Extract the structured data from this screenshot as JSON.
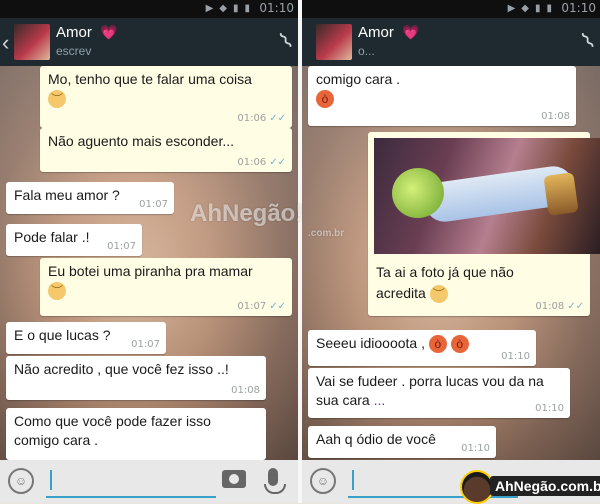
{
  "status_bar": {
    "time": "01:10"
  },
  "chat": {
    "contact_name": "Amor",
    "heart": "💗",
    "status_left": "escrev",
    "status_right": "o..."
  },
  "left_messages": [
    {
      "text": "Mo, tenho que te falar uma coisa",
      "emoji": "sad",
      "time": "01:06",
      "ticks": "✓✓"
    },
    {
      "text": "Não aguento mais esconder...",
      "time": "01:06",
      "ticks": "✓✓"
    },
    {
      "text": "Fala meu amor ?",
      "time": "01:07"
    },
    {
      "text": "Pode falar .!",
      "time": "01:07"
    },
    {
      "text": "Eu botei uma piranha pra mamar",
      "emoji": "sad",
      "time": "01:07",
      "ticks": "✓✓"
    },
    {
      "text": "E o que lucas ?",
      "time": "01:07"
    },
    {
      "text": "Não acredito , que você fez isso ..!",
      "time": "01:08"
    },
    {
      "text": "Como que você pode fazer isso comigo cara ."
    }
  ],
  "right_messages": [
    {
      "text": "comigo cara .",
      "emoji": "angry",
      "time": "01:08"
    },
    {
      "text": "Ta ai a foto já que não acredita",
      "emoji": "sad",
      "time": "01:08",
      "ticks": "✓✓"
    },
    {
      "text": "Seeeu idioooota ,",
      "emojis": [
        "angry",
        "angry"
      ],
      "time": "01:10"
    },
    {
      "text": "Vai se fudeer . porra lucas vou da na sua cara",
      "dots": "...",
      "time": "01:10"
    },
    {
      "text": "Aah q ódio de você",
      "time": "01:10"
    }
  ],
  "watermark": {
    "text": "AhNegão!",
    "sub": ".com.br"
  },
  "logo": {
    "text": "AhNegão.com.br"
  },
  "icons": {
    "back": "chevron-left-icon",
    "attach": "paperclip-icon",
    "smiley": "smiley-icon",
    "camera": "camera-icon",
    "mic": "mic-icon"
  }
}
